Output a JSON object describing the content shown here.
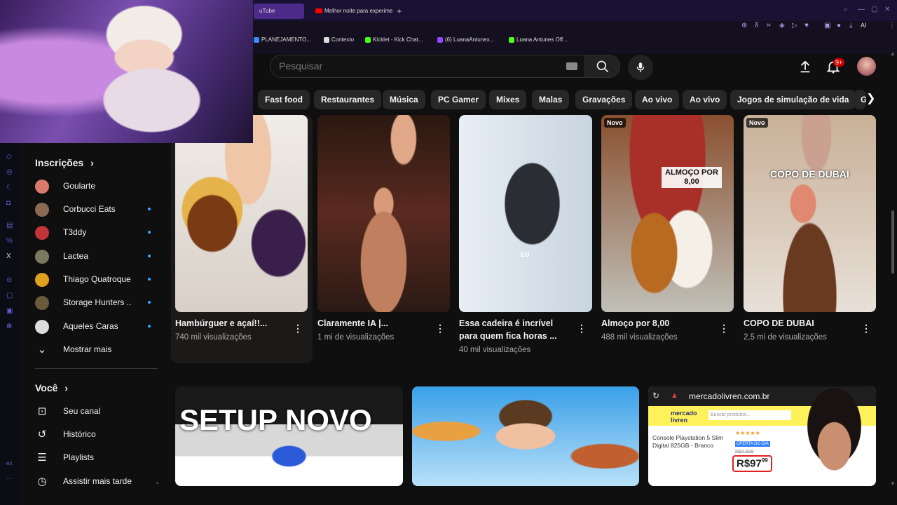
{
  "browser": {
    "tabs": [
      {
        "label": "uTube"
      },
      {
        "label": "Melhor noite para experime"
      }
    ],
    "new_tab_symbol": "+",
    "bookmarks": [
      {
        "label": "PLANEJAMENTO...",
        "color": "#3a8bff"
      },
      {
        "label": "Contexto",
        "color": "#dddddd"
      },
      {
        "label": "Kicklet - Kick Chat...",
        "color": "#53fc18"
      },
      {
        "label": "(6) LuanaAntunex...",
        "color": "#9146ff"
      },
      {
        "label": "Luana Antunes Off...",
        "color": "#53fc18"
      }
    ],
    "ai_label": "AI"
  },
  "header": {
    "search_placeholder": "Pesquisar",
    "notification_count": "9+"
  },
  "chips": [
    "Fast food",
    "Restaurantes",
    "Música",
    "PC Gamer",
    "Mixes",
    "Malas",
    "Gravações",
    "Ao vivo",
    "Ao vivo",
    "Jogos de simulação de vida",
    "G"
  ],
  "sidebar": {
    "subscriptions_title": "Inscrições",
    "subscriptions": [
      {
        "name": "Goularte",
        "new": false,
        "color": "#d97a6a"
      },
      {
        "name": "Corbucci Eats",
        "new": true,
        "color": "#8a6a50"
      },
      {
        "name": "T3ddy",
        "new": true,
        "color": "#c0343a"
      },
      {
        "name": "Lactea",
        "new": true,
        "color": "#7a7a60"
      },
      {
        "name": "Thiago Quatroque",
        "new": true,
        "color": "#e0a020"
      },
      {
        "name": "Storage Hunters ...",
        "new": true,
        "color": "#6a5a3a"
      },
      {
        "name": "Aqueles Caras",
        "new": true,
        "color": "#dddddd"
      }
    ],
    "show_more": "Mostrar mais",
    "you_title": "Você",
    "you_items": [
      {
        "label": "Seu canal",
        "icon": "channel-icon"
      },
      {
        "label": "Histórico",
        "icon": "history-icon"
      },
      {
        "label": "Playlists",
        "icon": "playlists-icon"
      },
      {
        "label": "Assistir mais tarde",
        "icon": "watch-later-icon"
      }
    ]
  },
  "videos": [
    {
      "title": "Hambúrguer e açaí!!...",
      "meta": "740 mil visualizações",
      "badge": ""
    },
    {
      "title": "Claramente IA |...",
      "meta": "1 mi de visualizações",
      "badge": ""
    },
    {
      "title": "Essa cadeira é incrível para quem fica horas ...",
      "meta": "40 mil visualizações",
      "badge": "",
      "overlay": "EU"
    },
    {
      "title": "Almoço por 8,00",
      "meta": "488 mil visualizações",
      "badge": "Novo",
      "overlay": "ALMOÇO POR 8,00"
    },
    {
      "title": "COPO DE DUBAI",
      "meta": "2,5 mi de visualizações",
      "badge": "Novo",
      "overlay": "COPO DE DUBAI"
    }
  ],
  "row2": [
    {
      "overlay": "SETUP NOVO"
    },
    {
      "overlay": ""
    },
    {
      "url": "mercadolivren.com.br",
      "brand": "mercado livren",
      "search": "Buscar produtos...",
      "product": "Console Playstation 5 Slim Digital 825GB - Branco",
      "offer": "OFERTA DO DIA",
      "old_price": "R$4.599",
      "price": "R$97",
      "cents": "99",
      "stars": "★★★★★"
    }
  ]
}
